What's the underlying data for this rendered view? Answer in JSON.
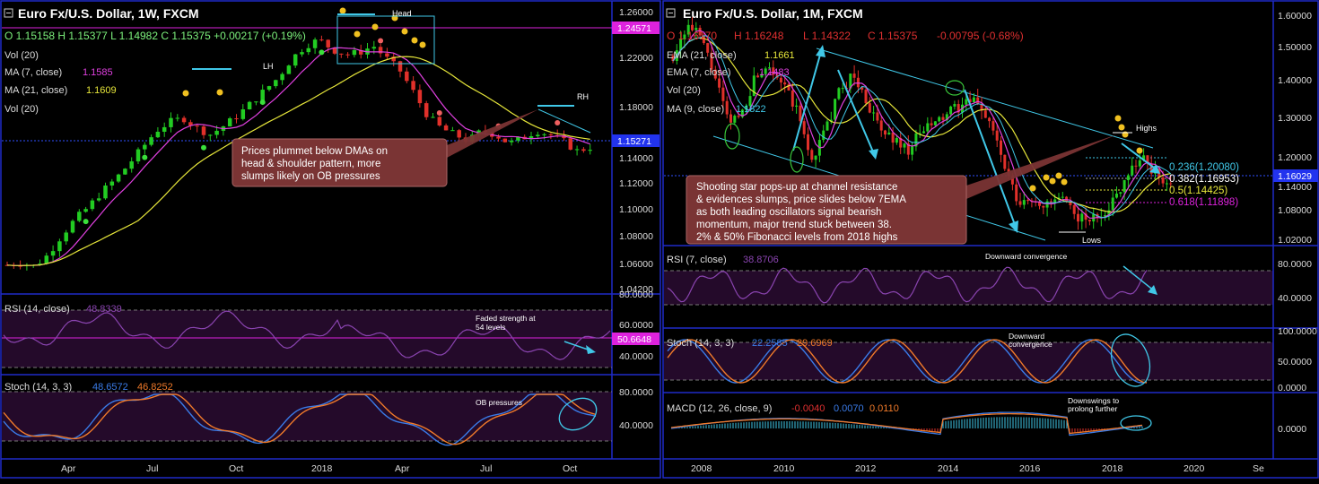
{
  "colors": {
    "bg": "#000000",
    "panel_bg": "#240a2a",
    "axis_blue": "#1f2bc8",
    "up": "#22cc22",
    "down": "#e0302a",
    "ma_fast": "#e040e0",
    "ma_slow": "#e6e63a",
    "cyan": "#40c8e8",
    "stoch_k": "#3a7be8",
    "stoch_d": "#f07a2a",
    "rsi": "#8a44b0",
    "price_tag": "#2233ee",
    "pink_tag": "#dd22dd",
    "callout": "#7a3434"
  },
  "left": {
    "header": {
      "title": "Euro Fx/U.S. Dollar, 1W, FXCM",
      "ohlc": "O 1.15158  H 1.15377  L 1.14982  C 1.15375  +0.00217 (+0.19%)",
      "vol": "Vol (20)",
      "ma7_label": "MA (7, close)",
      "ma7_value": "1.1585",
      "ma21_label": "MA (21, close)",
      "ma21_value": "1.1609",
      "vol2": "Vol (20)"
    },
    "annotations": {
      "head": "Head",
      "lh": "LH",
      "rh": "RH",
      "callout": [
        "Prices plummet below DMAs on",
        "head & shoulder pattern, more",
        "slumps likely on OB pressures"
      ]
    },
    "price_axis": [
      "1.26000",
      "1.22000",
      "1.18000",
      "1.14000",
      "1.12000",
      "1.10000",
      "1.08000",
      "1.06000",
      "1.04200"
    ],
    "tags": {
      "pink": "1.24571",
      "blue": "1.15271"
    },
    "rsi": {
      "label": "RSI (14, close)",
      "value": "48.8339",
      "note": [
        "Faded strength at",
        "54 levels"
      ],
      "axis": [
        "80.0000",
        "60.0000",
        "40.0000"
      ],
      "tag": "50.6648"
    },
    "stoch": {
      "label": "Stoch (14, 3, 3)",
      "k": "48.6572",
      "d": "46.8252",
      "note": "OB pressures",
      "axis": [
        "80.0000",
        "40.0000"
      ]
    },
    "x_axis": [
      "Apr",
      "Jul",
      "Oct",
      "2018",
      "Apr",
      "Jul",
      "Oct"
    ]
  },
  "right": {
    "header": {
      "title": "Euro Fx/U.S. Dollar, 1M, FXCM",
      "ohlc_o": "O 1.16170",
      "ohlc_h": "H 1.16248",
      "ohlc_l": "L 1.14322",
      "ohlc_c": "C 1.15375",
      "ohlc_chg": "-0.00795 (-0.68%)",
      "ema21_label": "EMA (21, close)",
      "ema21_value": "1.1661",
      "ema7_label": "EMA (7, close)",
      "ema7_value": "1.1483",
      "vol": "Vol (20)",
      "ma9_label": "MA (9, close)",
      "ma9_value": "1.1822"
    },
    "annotations": {
      "highs": "Highs",
      "lows": "Lows",
      "callout": [
        "Shooting star pops-up at channel resistance",
        "& evidences slumps, price slides below 7EMA",
        "as both leading oscillators signal bearish",
        "momentum, major trend stuck between 38.",
        "2% & 50% Fibonacci levels from 2018 highs"
      ]
    },
    "fib": [
      "0.236(1.20080)",
      "0.382(1.16953)",
      "0.5(1.14425)",
      "0.618(1.11898)"
    ],
    "price_axis": [
      "1.60000",
      "1.50000",
      "1.40000",
      "1.30000",
      "1.20000",
      "1.14000",
      "1.08000",
      "1.02000"
    ],
    "tags": {
      "blue": "1.16029"
    },
    "rsi": {
      "label": "RSI (7, close)",
      "value": "38.8706",
      "note": "Downward convergence",
      "axis": [
        "80.0000",
        "40.0000"
      ]
    },
    "stoch": {
      "label": "Stoch (14, 3, 3)",
      "k": "22.2585",
      "d": "29.6969",
      "note": [
        "Downward",
        "convergence"
      ],
      "axis": [
        "100.0000",
        "50.0000",
        "0.0000"
      ]
    },
    "macd": {
      "label": "MACD (12, 26, close, 9)",
      "v1": "-0.0040",
      "v2": "0.0070",
      "v3": "0.0110",
      "note": [
        "Downswings to",
        "prolong further"
      ],
      "axis": [
        "0.0000"
      ]
    },
    "x_axis": [
      "2008",
      "2010",
      "2012",
      "2014",
      "2016",
      "2018",
      "2020",
      "Se"
    ]
  },
  "chart_data": [
    {
      "type": "candlestick",
      "title": "Euro Fx/U.S. Dollar, 1W, FXCM",
      "x": [
        "Apr",
        "Jul",
        "Oct",
        "2018",
        "Apr",
        "Jul",
        "Oct"
      ],
      "close_path": [
        1.062,
        1.064,
        1.061,
        1.07,
        1.085,
        1.098,
        1.108,
        1.12,
        1.13,
        1.142,
        1.155,
        1.168,
        1.175,
        1.178,
        1.17,
        1.165,
        1.172,
        1.18,
        1.19,
        1.2,
        1.21,
        1.225,
        1.235,
        1.24,
        1.232,
        1.228,
        1.23,
        1.235,
        1.225,
        1.215,
        1.198,
        1.18,
        1.17,
        1.165,
        1.16,
        1.168,
        1.165,
        1.158,
        1.162,
        1.168,
        1.165,
        1.16,
        1.152,
        1.155
      ],
      "ylim": [
        1.042,
        1.262
      ]
    },
    {
      "type": "candlestick",
      "title": "Euro Fx/U.S. Dollar, 1M, FXCM",
      "x": [
        "2008",
        "2010",
        "2012",
        "2014",
        "2016",
        "2018",
        "2020"
      ],
      "close_path": [
        1.5,
        1.58,
        1.55,
        1.45,
        1.32,
        1.35,
        1.45,
        1.48,
        1.42,
        1.35,
        1.22,
        1.3,
        1.4,
        1.45,
        1.38,
        1.3,
        1.28,
        1.25,
        1.3,
        1.32,
        1.35,
        1.37,
        1.38,
        1.32,
        1.2,
        1.1,
        1.12,
        1.1,
        1.12,
        1.08,
        1.06,
        1.08,
        1.12,
        1.2,
        1.23,
        1.18,
        1.16
      ],
      "ylim": [
        1.0,
        1.62
      ]
    }
  ]
}
